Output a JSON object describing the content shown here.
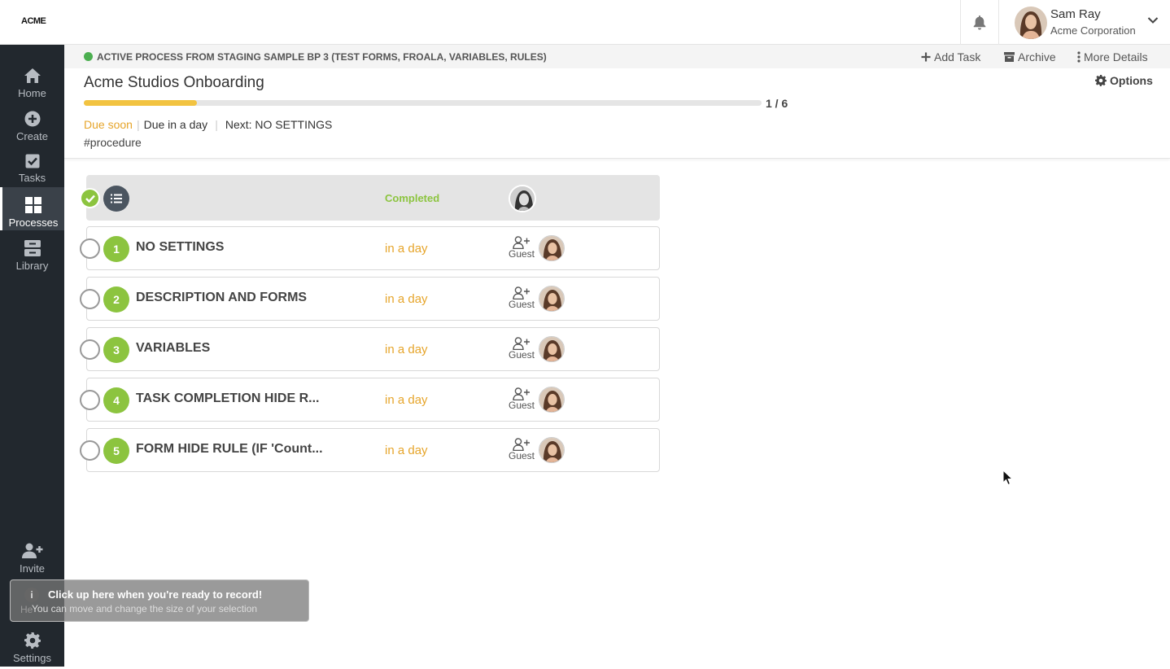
{
  "brand": {
    "logo_text": "ACME"
  },
  "topbar": {
    "user": {
      "name": "Sam Ray",
      "org": "Acme Corporation"
    }
  },
  "sidebar": {
    "items": [
      {
        "label": "Home",
        "icon": "home-icon"
      },
      {
        "label": "Create",
        "icon": "plus-circle-icon"
      },
      {
        "label": "Tasks",
        "icon": "checkbox-icon"
      },
      {
        "label": "Processes",
        "icon": "grid-icon"
      },
      {
        "label": "Library",
        "icon": "archive-box-icon"
      },
      {
        "label": "Invite",
        "icon": "user-plus-icon"
      },
      {
        "label": "Settings",
        "icon": "gear-icon"
      }
    ],
    "active": "Processes"
  },
  "process": {
    "status_text": "ACTIVE PROCESS FROM STAGING SAMPLE BP 3 (TEST FORMS, FROALA, VARIABLES, RULES)",
    "status_color": "#4caf50",
    "actions": {
      "add_task": "Add Task",
      "archive": "Archive",
      "more_details": "More Details"
    },
    "title": "Acme Studios Onboarding",
    "options_label": "Options",
    "progress": {
      "label": "1 / 6",
      "fraction": 0.1667,
      "color": "#f2c341"
    },
    "due_soon": "Due soon",
    "due_in": "Due in a day",
    "next": "Next: NO SETTINGS",
    "tag": "#procedure"
  },
  "tasks": {
    "completed_row": {
      "status": "Completed"
    },
    "guest_label": "Guest",
    "rows": [
      {
        "num": "1",
        "name": "NO SETTINGS",
        "due": "in a day"
      },
      {
        "num": "2",
        "name": "DESCRIPTION AND FORMS",
        "due": "in a day"
      },
      {
        "num": "3",
        "name": "VARIABLES",
        "due": "in a day"
      },
      {
        "num": "4",
        "name": "TASK COMPLETION HIDE R...",
        "due": "in a day"
      },
      {
        "num": "5",
        "name": "FORM HIDE RULE (IF 'Count...",
        "due": "in a day"
      }
    ]
  },
  "toast": {
    "title": "Click up here when you're ready to record!",
    "subtitle": "You can move and change the size of your selection",
    "behind_text": "He"
  },
  "colors": {
    "accent_green": "#8cc43f",
    "due_orange": "#e6a52b",
    "sidebar_bg": "#22282e"
  }
}
